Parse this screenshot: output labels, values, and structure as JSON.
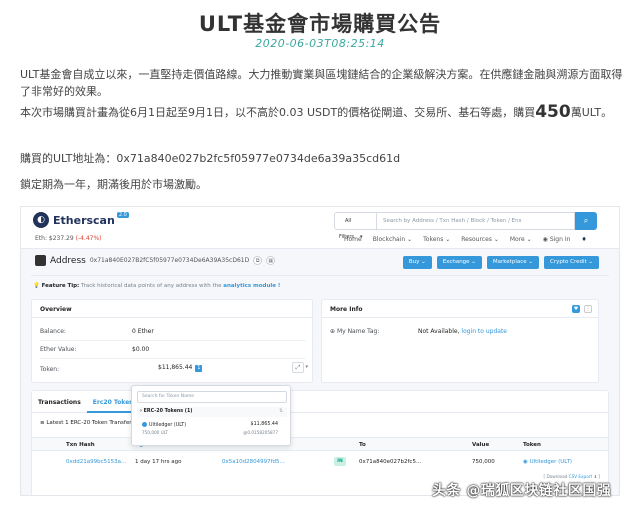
{
  "article": {
    "title": "ULT基金會市場購買公告",
    "date": "2020-06-03T08:25:14",
    "p1": "ULT基金會自成立以來，一直堅持走價值路線。大力推動實業與區塊鏈結合的企業級解決方案。在供應鏈金融與溯源方面取得了非常好的效果。",
    "p2_before": "本次市場購買計畫為從6月1日起至9月1日，以不高於0.03 USDT的價格從閘道、交易所、基石等處，購買",
    "p2_number": "450",
    "p2_after": "萬ULT。",
    "p3": "購買的ULT地址為：0x71a840e027b2fc5f05977e0734de6a39a35cd61d",
    "p4": "鎖定期為一年，期滿後用於市場激勵。"
  },
  "etherscan": {
    "logo": "Etherscan",
    "logo_badge": "2.0",
    "eth_price_label": "Eth: $237.29",
    "eth_change": "(-4.47%)",
    "filter": "All Filters",
    "search_placeholder": "Search by Address / Txn Hash / Block / Token / Ens",
    "nav": [
      "Home",
      "Blockchain ⌄",
      "Tokens ⌄",
      "Resources ⌄",
      "More ⌄",
      "Sign In"
    ],
    "address_label": "Address",
    "address_hash": "0x71a840E027B2fC5f05977e0734De6A39A35cD61D",
    "buttons": [
      "Buy ⌄",
      "Exchange ⌄",
      "Marketplace ⌄",
      "Crypto Credit ⌄"
    ],
    "feature_tip_label": "Feature Tip:",
    "feature_tip_text": "Track historical data points of any address with the",
    "feature_tip_link": "analytics module !",
    "overview": {
      "title": "Overview",
      "balance_label": "Balance:",
      "balance_value": "0 Ether",
      "ether_value_label": "Ether Value:",
      "ether_value": "$0.00",
      "token_label": "Token:",
      "token_value": "$11,865.44",
      "token_count": "1"
    },
    "more_info": {
      "title": "More Info",
      "name_tag_label": "My Name Tag:",
      "name_tag_value": "Not Available,",
      "name_tag_link": "login to update"
    },
    "dropdown": {
      "search_placeholder": "Search for Token Name",
      "group": "ERC-20 Tokens (1)",
      "item_name": "Ultiledger (ULT)",
      "item_amount": "$11,865.44",
      "item_qty": "750,000 ULT",
      "item_rate": "@0.0158205877"
    },
    "tabs": [
      "Transactions",
      "Erc20 Token Txns"
    ],
    "latest": "Latest 1 ERC-20 Token Transfer Events",
    "table": {
      "headers": [
        "Txn Hash",
        "Age",
        "To",
        "Value",
        "Token"
      ],
      "row": {
        "hash": "0xdd21a99bc5153a…",
        "age": "1 day 17 hrs ago",
        "from": "0x5a10d2804997fd5…",
        "direction": "IN",
        "to": "0x71a840e027b2fc5…",
        "value": "750,000",
        "token": "Ultiledger (ULT)"
      }
    },
    "csv_prefix": "[ Download",
    "csv_link": "CSV Export",
    "csv_suffix": "]"
  },
  "watermark": "头条 @瑞狐区块链社区国强"
}
